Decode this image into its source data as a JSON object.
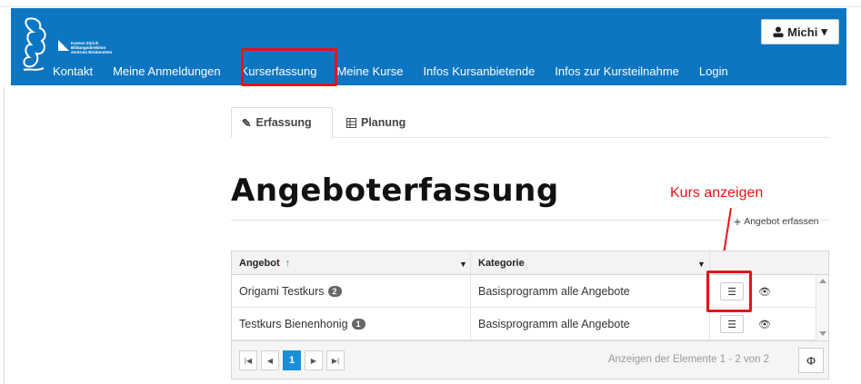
{
  "brand": {
    "logo_lines": [
      "Kanton Zürich",
      "Bildungsdirektion",
      "Zentrum Breitenstein"
    ]
  },
  "user_menu": {
    "label": "Michi",
    "icon": "user-icon",
    "caret": "▾"
  },
  "nav": {
    "items": [
      {
        "label": "Kontakt"
      },
      {
        "label": "Meine Anmeldungen"
      },
      {
        "label": "Kurserfassung"
      },
      {
        "label": "Meine Kurse"
      },
      {
        "label": "Infos Kursanbietende"
      },
      {
        "label": "Infos zur Kursteilnahme"
      },
      {
        "label": "Login"
      }
    ]
  },
  "tabs": [
    {
      "label": "Erfassung",
      "icon": "pencil-icon"
    },
    {
      "label": "Planung",
      "icon": "table-icon"
    }
  ],
  "page": {
    "title": "Angeboterfassung",
    "add_label": "Angebot erfassen",
    "annotation": "Kurs anzeigen"
  },
  "grid": {
    "columns": [
      {
        "label": "Angebot",
        "sort": "↑"
      },
      {
        "label": "Kategorie"
      }
    ],
    "rows": [
      {
        "angebot": "Origami Testkurs",
        "count": "2",
        "kategorie": "Basisprogramm alle Angebote"
      },
      {
        "angebot": "Testkurs Bienenhonig",
        "count": "1",
        "kategorie": "Basisprogramm alle Angebote"
      }
    ],
    "pager": {
      "current_page": "1",
      "info": "Anzeigen der Elemente 1 - 2 von 2"
    }
  },
  "colors": {
    "header_bg": "#0c76c2",
    "highlight": "#e3151a",
    "pager_active": "#1a8fd6"
  }
}
